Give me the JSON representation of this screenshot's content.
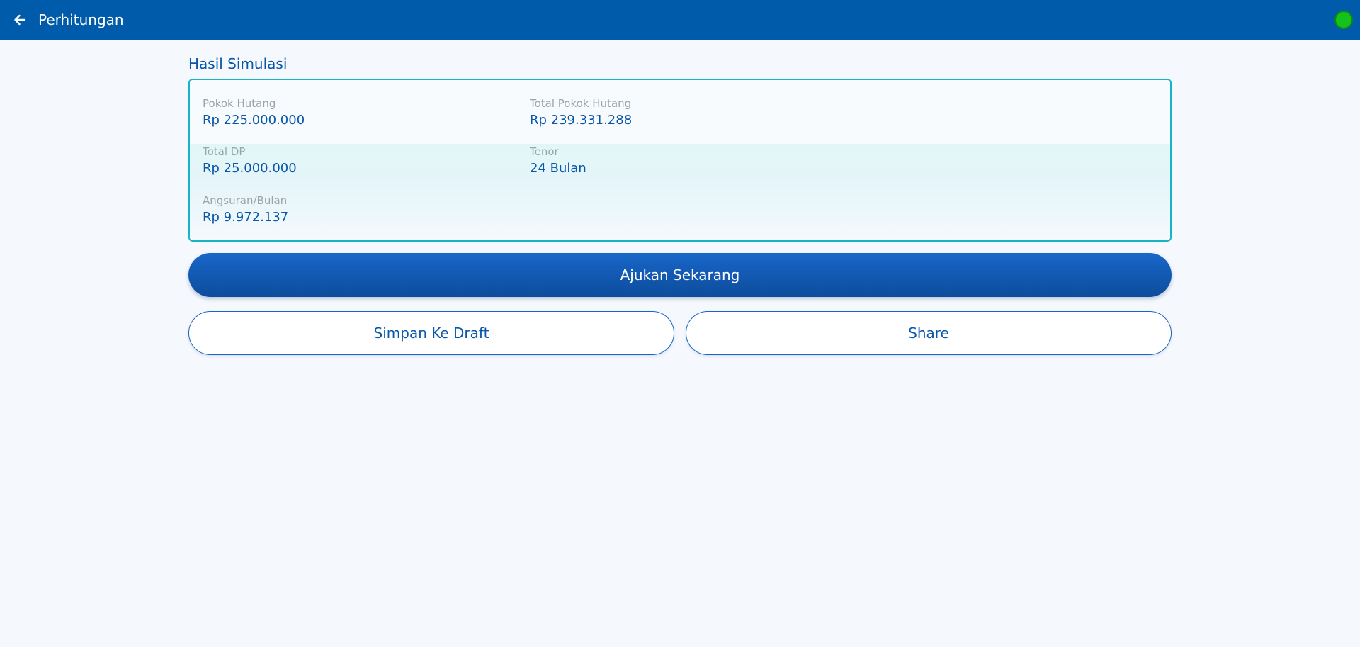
{
  "appbar": {
    "title": "Perhitungan",
    "back_icon": "arrow-left-icon",
    "status_color": "#15c21b"
  },
  "result": {
    "section_title": "Hasil Simulasi",
    "fields": {
      "pokok_hutang": {
        "label": "Pokok Hutang",
        "value": "Rp 225.000.000"
      },
      "total_pokok_hutang": {
        "label": "Total Pokok Hutang",
        "value": "Rp 239.331.288"
      },
      "total_dp": {
        "label": "Total DP",
        "value": "Rp 25.000.000"
      },
      "tenor": {
        "label": "Tenor",
        "value": "24 Bulan"
      },
      "angsuran": {
        "label": "Angsuran/Bulan",
        "value": "Rp 9.972.137"
      }
    }
  },
  "actions": {
    "submit_label": "Ajukan Sekarang",
    "draft_label": "Simpan Ke Draft",
    "share_label": "Share"
  },
  "colors": {
    "appbar": "#005bab",
    "accent": "#0a56a8",
    "card_border": "#19b4c3"
  }
}
